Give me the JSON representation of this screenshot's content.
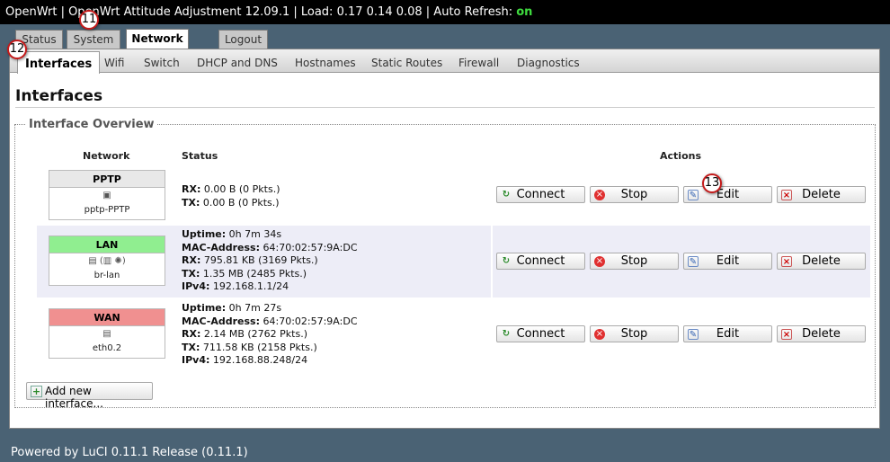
{
  "header": {
    "title": "OpenWrt | OpenWrt Attitude Adjustment 12.09.1 | Load: 0.17 0.14 0.08 | Auto Refresh: ",
    "auto_refresh": "on"
  },
  "main_tabs": [
    {
      "label": "Status"
    },
    {
      "label": "System"
    },
    {
      "label": "Network"
    },
    {
      "label": "Logout"
    }
  ],
  "sub_tabs": [
    {
      "label": "Interfaces"
    },
    {
      "label": "Wifi"
    },
    {
      "label": "Switch"
    },
    {
      "label": "DHCP and DNS"
    },
    {
      "label": "Hostnames"
    },
    {
      "label": "Static Routes"
    },
    {
      "label": "Firewall"
    },
    {
      "label": "Diagnostics"
    }
  ],
  "page_title": "Interfaces",
  "overview": {
    "legend": "Interface Overview",
    "col_network": "Network",
    "col_status": "Status",
    "col_actions": "Actions"
  },
  "interfaces": [
    {
      "name": "PPTP",
      "device": "pptp-PPTP",
      "color": "#e8e8e8",
      "status": {
        "rx_label": "RX:",
        "rx": " 0.00 B (0 Pkts.)",
        "tx_label": "TX:",
        "tx": " 0.00 B (0 Pkts.)"
      }
    },
    {
      "name": "LAN",
      "device": "br-lan",
      "color": "#90ee90",
      "status": {
        "uptime_label": "Uptime:",
        "uptime": " 0h 7m 34s",
        "mac_label": "MAC-Address:",
        "mac": " 64:70:02:57:9A:DC",
        "rx_label": "RX:",
        "rx": " 795.81 KB (3169 Pkts.)",
        "tx_label": "TX:",
        "tx": " 1.35 MB (2485 Pkts.)",
        "ipv4_label": "IPv4:",
        "ipv4": " 192.168.1.1/24"
      }
    },
    {
      "name": "WAN",
      "device": "eth0.2",
      "color": "#f09090",
      "status": {
        "uptime_label": "Uptime:",
        "uptime": " 0h 7m 27s",
        "mac_label": "MAC-Address:",
        "mac": " 64:70:02:57:9A:DC",
        "rx_label": "RX:",
        "rx": " 2.14 MB (2762 Pkts.)",
        "tx_label": "TX:",
        "tx": " 711.58 KB (2158 Pkts.)",
        "ipv4_label": "IPv4:",
        "ipv4": " 192.168.88.248/24"
      }
    }
  ],
  "actions": {
    "connect": "Connect",
    "stop": "Stop",
    "edit": "Edit",
    "delete": "Delete"
  },
  "add_interface_label": "Add new interface...",
  "footer": "Powered by LuCI 0.11.1 Release (0.11.1)",
  "callouts": {
    "c11": "11",
    "c12": "12",
    "c13": "13"
  },
  "icons": {
    "connect": "refresh-icon",
    "stop": "stop-icon",
    "edit": "edit-icon",
    "delete": "delete-icon",
    "add": "add-icon"
  }
}
